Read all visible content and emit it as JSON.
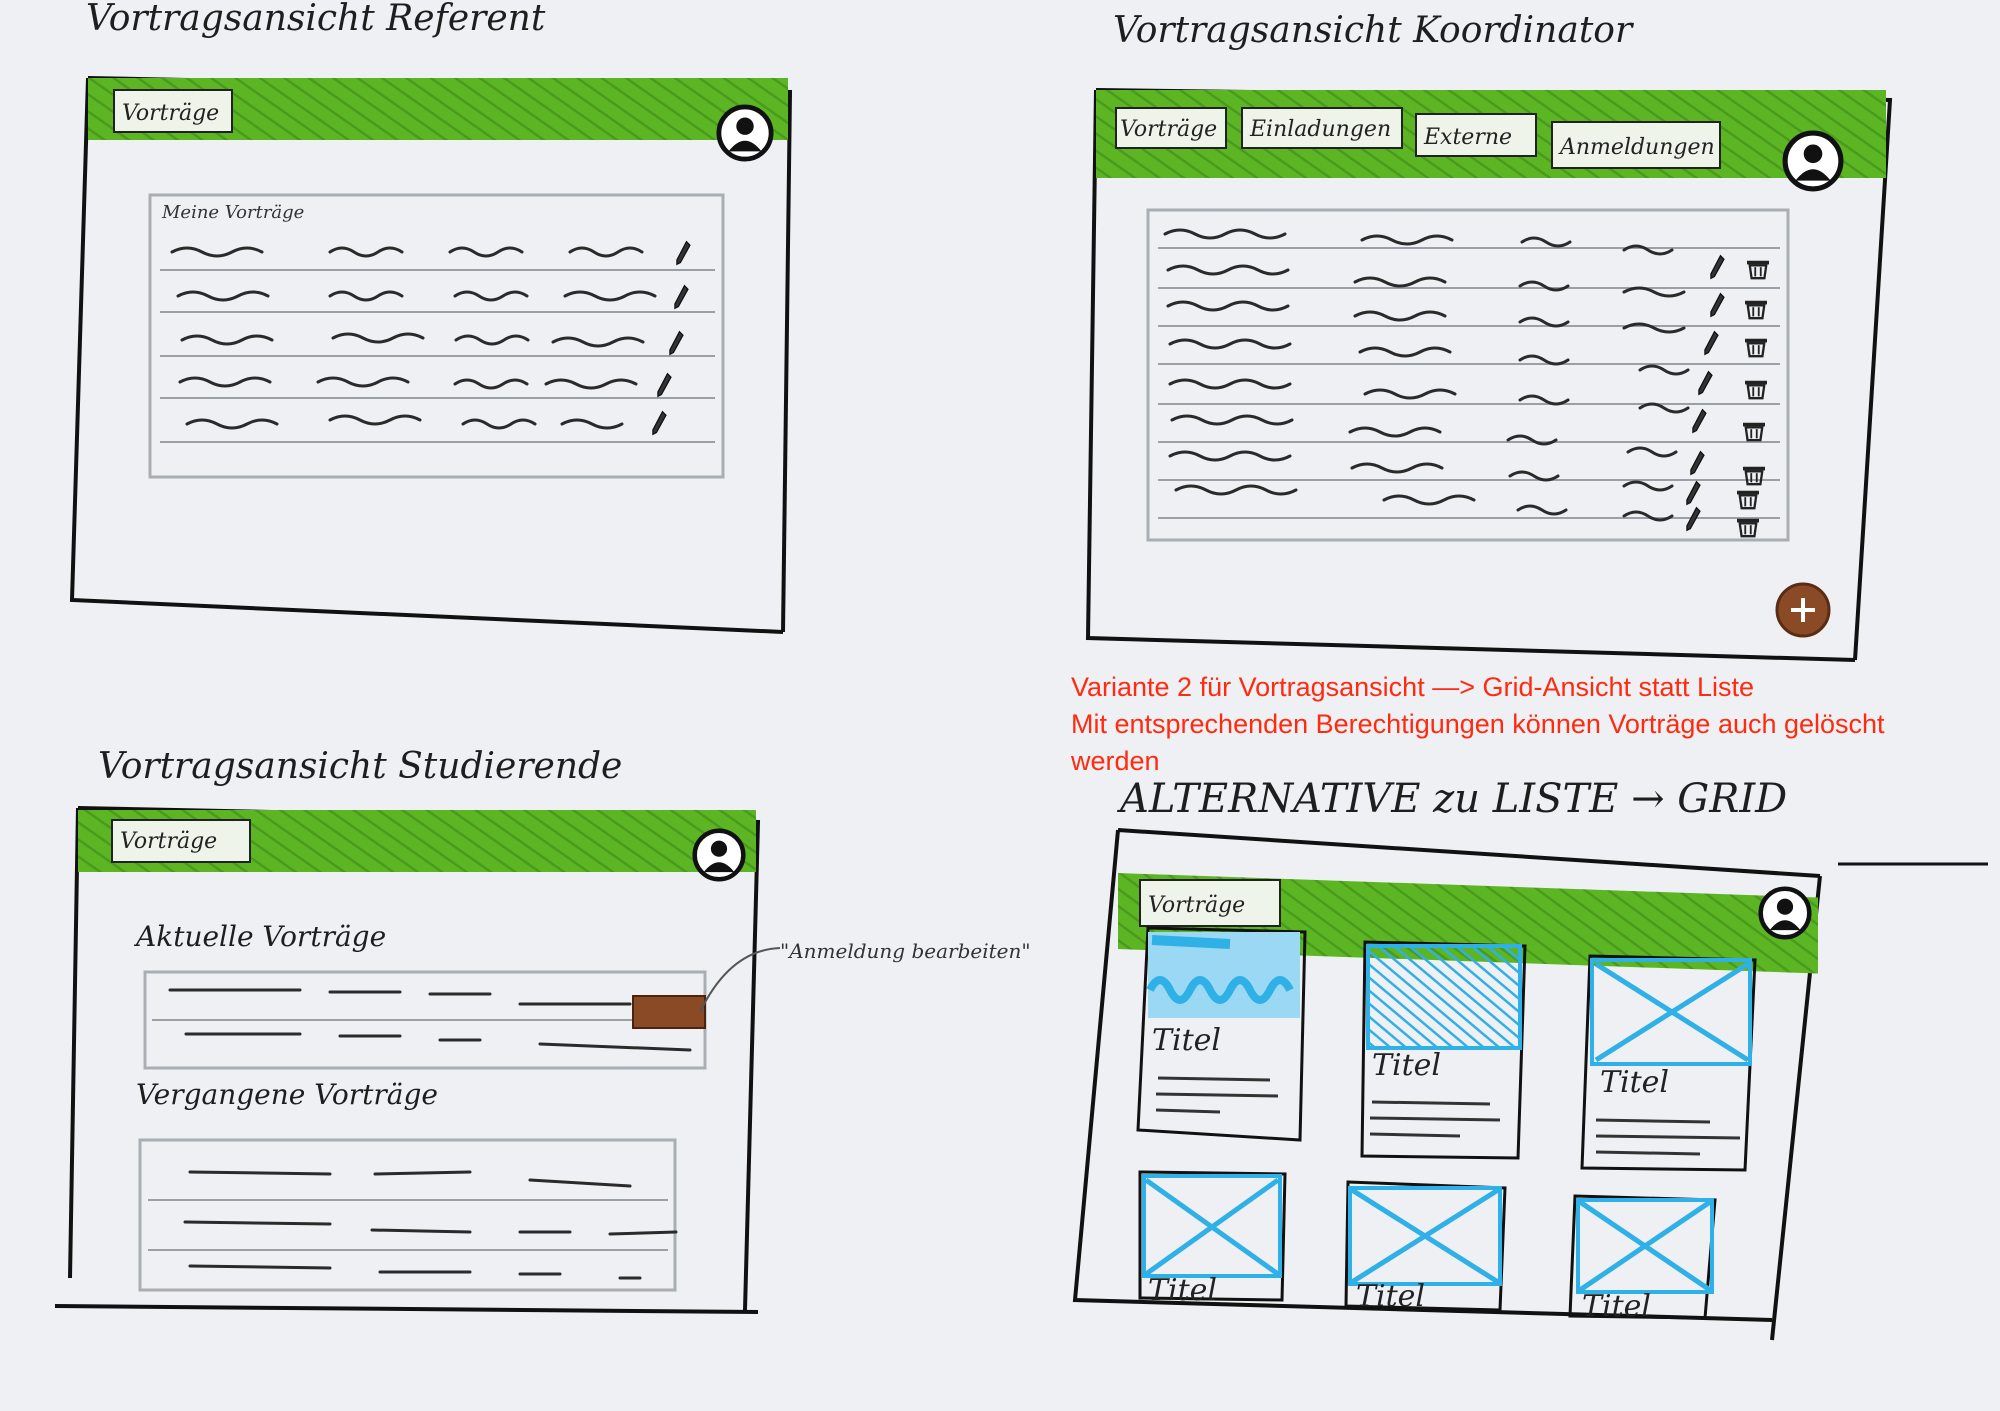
{
  "colors": {
    "header_green": "#5cb624",
    "accent_brown": "#8b4a26",
    "sketch_blue": "#2fb0e6",
    "note_red": "#ff2a10",
    "paper": "#eef0f3"
  },
  "panels": {
    "referent": {
      "title": "Vortragsansicht Referent",
      "tab": "Vorträge",
      "table_title": "Meine Vorträge",
      "avatar_icon": "user-avatar-icon",
      "row_icon": "edit-pencil-icon"
    },
    "koordinator": {
      "title": "Vortragsansicht Koordinator",
      "tabs": [
        "Vorträge",
        "Einladungen",
        "Externe",
        "Anmeldungen"
      ],
      "avatar_icon": "user-avatar-icon",
      "row_icons": [
        "edit-pencil-icon",
        "delete-trash-icon"
      ],
      "fab_icon": "add-icon"
    },
    "studierende": {
      "title": "Vortragsansicht Studierende",
      "tab": "Vorträge",
      "section_current": "Aktuelle Vorträge",
      "section_past": "Vergangene Vorträge",
      "annotation": "\"Anmeldung bearbeiten\"",
      "avatar_icon": "user-avatar-icon"
    },
    "grid": {
      "title": "ALTERNATIVE zu LISTE → GRID",
      "tab": "Vorträge",
      "tile_label": "Titel",
      "avatar_icon": "user-avatar-icon"
    }
  },
  "note": {
    "line1": "Variante 2 für Vortragsansicht —> Grid-Ansicht statt Liste",
    "line2": "Mit entsprechenden Berechtigungen können Vorträge auch gelöscht werden"
  }
}
